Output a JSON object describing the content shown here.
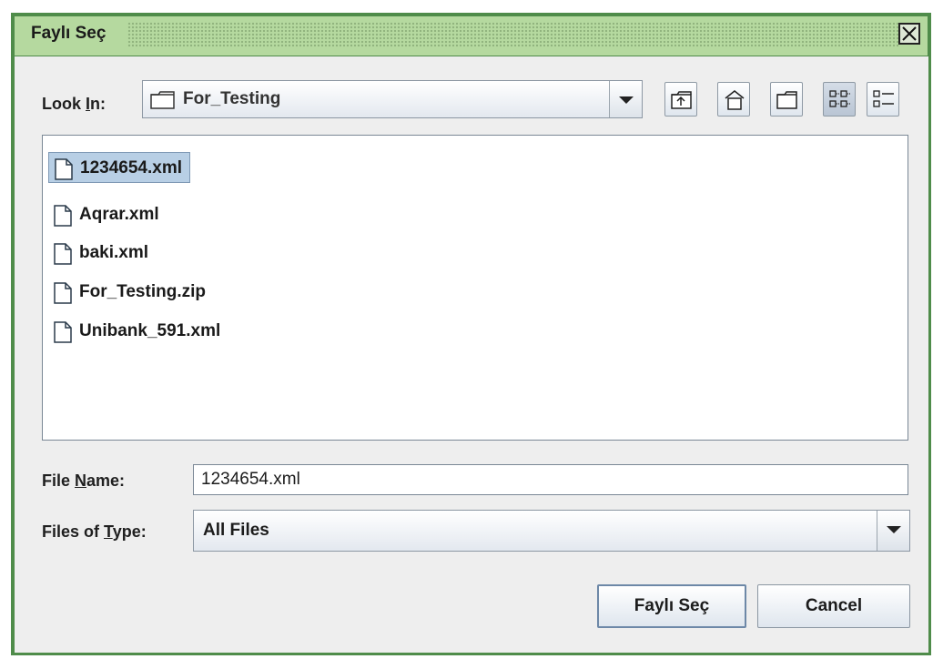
{
  "window": {
    "title": "Faylı Seç"
  },
  "look_in": {
    "label_prefix": "Look ",
    "label_mnemonic": "I",
    "label_suffix": "n:",
    "selected": "For_Testing"
  },
  "toolbar": {
    "buttons": [
      "up-one-level",
      "home",
      "new-folder",
      "list-view",
      "details-view"
    ]
  },
  "files": [
    {
      "name": "1234654.xml",
      "selected": true
    },
    {
      "name": "Aqrar.xml",
      "selected": false
    },
    {
      "name": "baki.xml",
      "selected": false
    },
    {
      "name": "For_Testing.zip",
      "selected": false
    },
    {
      "name": "Unibank_591.xml",
      "selected": false
    }
  ],
  "file_name": {
    "label_prefix": "File ",
    "label_mnemonic": "N",
    "label_suffix": "ame:",
    "value": "1234654.xml"
  },
  "files_of_type": {
    "label_prefix": "Files of ",
    "label_mnemonic": "T",
    "label_suffix": "ype:",
    "selected": "All Files"
  },
  "buttons": {
    "approve": "Faylı Seç",
    "cancel": "Cancel"
  },
  "colors": {
    "title_bar": "#b5d99f",
    "window_border": "#4f8c4a",
    "selection": "#b8cfe5"
  }
}
